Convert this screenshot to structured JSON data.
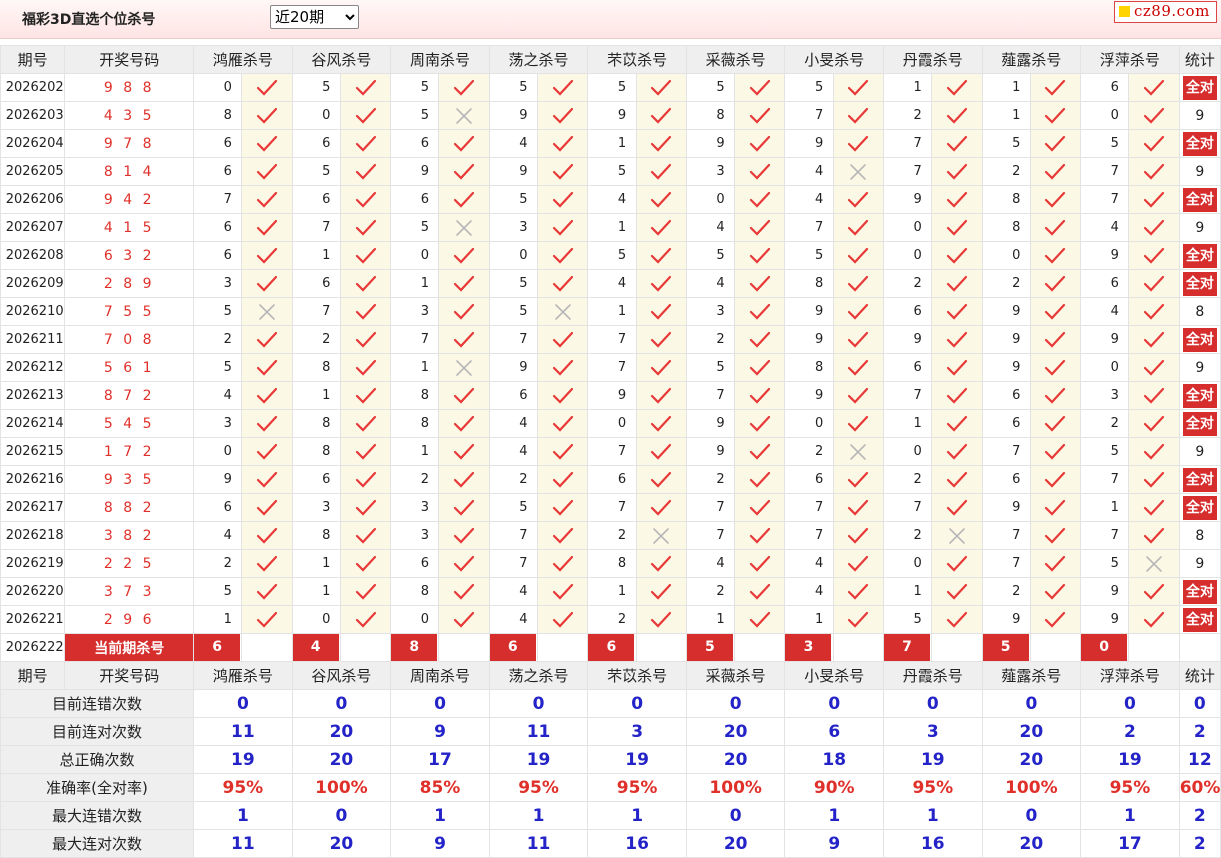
{
  "app": {
    "title": "福彩3D直选个位杀号",
    "period_select": "近20期",
    "logo_text": "cz89.com"
  },
  "columns": {
    "period": "期号",
    "winning": "开奖号码",
    "stat": "统计",
    "experts": [
      "鸿雁杀号",
      "谷风杀号",
      "周南杀号",
      "荡之杀号",
      "芣苡杀号",
      "采薇杀号",
      "小旻杀号",
      "丹霞杀号",
      "薤露杀号",
      "浮萍杀号"
    ]
  },
  "rows": [
    {
      "period": "2026202",
      "winning": "9 8 8",
      "kills": [
        "0",
        "5",
        "5",
        "5",
        "5",
        "5",
        "5",
        "1",
        "1",
        "6"
      ],
      "marks": [
        "ok",
        "ok",
        "ok",
        "ok",
        "ok",
        "ok",
        "ok",
        "ok",
        "ok",
        "ok"
      ],
      "stat": "全对"
    },
    {
      "period": "2026203",
      "winning": "4 3 5",
      "kills": [
        "8",
        "0",
        "5",
        "9",
        "9",
        "8",
        "7",
        "2",
        "1",
        "0"
      ],
      "marks": [
        "ok",
        "ok",
        "x",
        "ok",
        "ok",
        "ok",
        "ok",
        "ok",
        "ok",
        "ok"
      ],
      "stat": "9"
    },
    {
      "period": "2026204",
      "winning": "9 7 8",
      "kills": [
        "6",
        "6",
        "6",
        "4",
        "1",
        "9",
        "9",
        "7",
        "5",
        "5"
      ],
      "marks": [
        "ok",
        "ok",
        "ok",
        "ok",
        "ok",
        "ok",
        "ok",
        "ok",
        "ok",
        "ok"
      ],
      "stat": "全对"
    },
    {
      "period": "2026205",
      "winning": "8 1 4",
      "kills": [
        "6",
        "5",
        "9",
        "9",
        "5",
        "3",
        "4",
        "7",
        "2",
        "7"
      ],
      "marks": [
        "ok",
        "ok",
        "ok",
        "ok",
        "ok",
        "ok",
        "x",
        "ok",
        "ok",
        "ok"
      ],
      "stat": "9"
    },
    {
      "period": "2026206",
      "winning": "9 4 2",
      "kills": [
        "7",
        "6",
        "6",
        "5",
        "4",
        "0",
        "4",
        "9",
        "8",
        "7"
      ],
      "marks": [
        "ok",
        "ok",
        "ok",
        "ok",
        "ok",
        "ok",
        "ok",
        "ok",
        "ok",
        "ok"
      ],
      "stat": "全对"
    },
    {
      "period": "2026207",
      "winning": "4 1 5",
      "kills": [
        "6",
        "7",
        "5",
        "3",
        "1",
        "4",
        "7",
        "0",
        "8",
        "4"
      ],
      "marks": [
        "ok",
        "ok",
        "x",
        "ok",
        "ok",
        "ok",
        "ok",
        "ok",
        "ok",
        "ok"
      ],
      "stat": "9"
    },
    {
      "period": "2026208",
      "winning": "6 3 2",
      "kills": [
        "6",
        "1",
        "0",
        "0",
        "5",
        "5",
        "5",
        "0",
        "0",
        "9"
      ],
      "marks": [
        "ok",
        "ok",
        "ok",
        "ok",
        "ok",
        "ok",
        "ok",
        "ok",
        "ok",
        "ok"
      ],
      "stat": "全对"
    },
    {
      "period": "2026209",
      "winning": "2 8 9",
      "kills": [
        "3",
        "6",
        "1",
        "5",
        "4",
        "4",
        "8",
        "2",
        "2",
        "6"
      ],
      "marks": [
        "ok",
        "ok",
        "ok",
        "ok",
        "ok",
        "ok",
        "ok",
        "ok",
        "ok",
        "ok"
      ],
      "stat": "全对"
    },
    {
      "period": "2026210",
      "winning": "7 5 5",
      "kills": [
        "5",
        "7",
        "3",
        "5",
        "1",
        "3",
        "9",
        "6",
        "9",
        "4"
      ],
      "marks": [
        "x",
        "ok",
        "ok",
        "x",
        "ok",
        "ok",
        "ok",
        "ok",
        "ok",
        "ok"
      ],
      "stat": "8"
    },
    {
      "period": "2026211",
      "winning": "7 0 8",
      "kills": [
        "2",
        "2",
        "7",
        "7",
        "7",
        "2",
        "9",
        "9",
        "9",
        "9"
      ],
      "marks": [
        "ok",
        "ok",
        "ok",
        "ok",
        "ok",
        "ok",
        "ok",
        "ok",
        "ok",
        "ok"
      ],
      "stat": "全对"
    },
    {
      "period": "2026212",
      "winning": "5 6 1",
      "kills": [
        "5",
        "8",
        "1",
        "9",
        "7",
        "5",
        "8",
        "6",
        "9",
        "0"
      ],
      "marks": [
        "ok",
        "ok",
        "x",
        "ok",
        "ok",
        "ok",
        "ok",
        "ok",
        "ok",
        "ok"
      ],
      "stat": "9"
    },
    {
      "period": "2026213",
      "winning": "8 7 2",
      "kills": [
        "4",
        "1",
        "8",
        "6",
        "9",
        "7",
        "9",
        "7",
        "6",
        "3"
      ],
      "marks": [
        "ok",
        "ok",
        "ok",
        "ok",
        "ok",
        "ok",
        "ok",
        "ok",
        "ok",
        "ok"
      ],
      "stat": "全对"
    },
    {
      "period": "2026214",
      "winning": "5 4 5",
      "kills": [
        "3",
        "8",
        "8",
        "4",
        "0",
        "9",
        "0",
        "1",
        "6",
        "2"
      ],
      "marks": [
        "ok",
        "ok",
        "ok",
        "ok",
        "ok",
        "ok",
        "ok",
        "ok",
        "ok",
        "ok"
      ],
      "stat": "全对"
    },
    {
      "period": "2026215",
      "winning": "1 7 2",
      "kills": [
        "0",
        "8",
        "1",
        "4",
        "7",
        "9",
        "2",
        "0",
        "7",
        "5"
      ],
      "marks": [
        "ok",
        "ok",
        "ok",
        "ok",
        "ok",
        "ok",
        "x",
        "ok",
        "ok",
        "ok"
      ],
      "stat": "9"
    },
    {
      "period": "2026216",
      "winning": "9 3 5",
      "kills": [
        "9",
        "6",
        "2",
        "2",
        "6",
        "2",
        "6",
        "2",
        "6",
        "7"
      ],
      "marks": [
        "ok",
        "ok",
        "ok",
        "ok",
        "ok",
        "ok",
        "ok",
        "ok",
        "ok",
        "ok"
      ],
      "stat": "全对"
    },
    {
      "period": "2026217",
      "winning": "8 8 2",
      "kills": [
        "6",
        "3",
        "3",
        "5",
        "7",
        "7",
        "7",
        "7",
        "9",
        "1"
      ],
      "marks": [
        "ok",
        "ok",
        "ok",
        "ok",
        "ok",
        "ok",
        "ok",
        "ok",
        "ok",
        "ok"
      ],
      "stat": "全对"
    },
    {
      "period": "2026218",
      "winning": "3 8 2",
      "kills": [
        "4",
        "8",
        "3",
        "7",
        "2",
        "7",
        "7",
        "2",
        "7",
        "7"
      ],
      "marks": [
        "ok",
        "ok",
        "ok",
        "ok",
        "x",
        "ok",
        "ok",
        "x",
        "ok",
        "ok"
      ],
      "stat": "8"
    },
    {
      "period": "2026219",
      "winning": "2 2 5",
      "kills": [
        "2",
        "1",
        "6",
        "7",
        "8",
        "4",
        "4",
        "0",
        "7",
        "5"
      ],
      "marks": [
        "ok",
        "ok",
        "ok",
        "ok",
        "ok",
        "ok",
        "ok",
        "ok",
        "ok",
        "x"
      ],
      "stat": "9"
    },
    {
      "period": "2026220",
      "winning": "3 7 3",
      "kills": [
        "5",
        "1",
        "8",
        "4",
        "1",
        "2",
        "4",
        "1",
        "2",
        "9"
      ],
      "marks": [
        "ok",
        "ok",
        "ok",
        "ok",
        "ok",
        "ok",
        "ok",
        "ok",
        "ok",
        "ok"
      ],
      "stat": "全对"
    },
    {
      "period": "2026221",
      "winning": "2 9 6",
      "kills": [
        "1",
        "0",
        "0",
        "4",
        "2",
        "1",
        "1",
        "5",
        "9",
        "9"
      ],
      "marks": [
        "ok",
        "ok",
        "ok",
        "ok",
        "ok",
        "ok",
        "ok",
        "ok",
        "ok",
        "ok"
      ],
      "stat": "全对"
    }
  ],
  "current": {
    "period": "2026222",
    "label": "当前期杀号",
    "kills": [
      "6",
      "4",
      "8",
      "6",
      "6",
      "5",
      "3",
      "7",
      "5",
      "0"
    ]
  },
  "summary": [
    {
      "label": "目前连错次数",
      "values": [
        "0",
        "0",
        "0",
        "0",
        "0",
        "0",
        "0",
        "0",
        "0",
        "0"
      ],
      "stat": "0"
    },
    {
      "label": "目前连对次数",
      "values": [
        "11",
        "20",
        "9",
        "11",
        "3",
        "20",
        "6",
        "3",
        "20",
        "2"
      ],
      "stat": "2"
    },
    {
      "label": "总正确次数",
      "values": [
        "19",
        "20",
        "17",
        "19",
        "19",
        "20",
        "18",
        "19",
        "20",
        "19"
      ],
      "stat": "12"
    },
    {
      "label": "准确率(全对率)",
      "values": [
        "95%",
        "100%",
        "85%",
        "95%",
        "95%",
        "100%",
        "90%",
        "95%",
        "100%",
        "95%"
      ],
      "stat": "60%",
      "red": true
    },
    {
      "label": "最大连错次数",
      "values": [
        "1",
        "0",
        "1",
        "1",
        "1",
        "0",
        "1",
        "1",
        "0",
        "1"
      ],
      "stat": "2"
    },
    {
      "label": "最大连对次数",
      "values": [
        "11",
        "20",
        "9",
        "11",
        "16",
        "20",
        "9",
        "16",
        "20",
        "17"
      ],
      "stat": "2"
    }
  ],
  "colors": {
    "accent_red": "#d62d2d",
    "number_red": "#e0302a",
    "stat_blue": "#2323c8",
    "mark_bg": "#fbf9e5"
  },
  "icons": {
    "ok": "check-icon",
    "x": "cross-icon"
  }
}
